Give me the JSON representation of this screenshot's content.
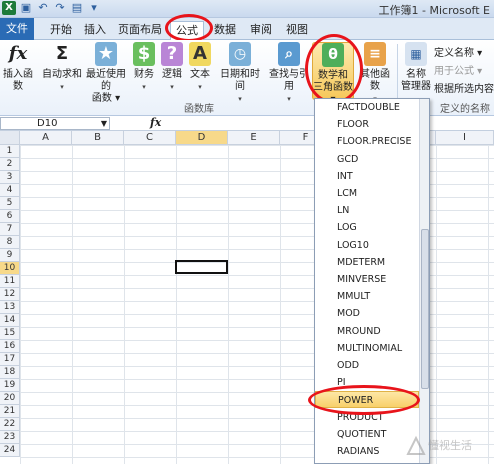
{
  "window": {
    "title": "工作簿1 - Microsoft E"
  },
  "tabs": [
    "文件",
    "开始",
    "插入",
    "页面布局",
    "公式",
    "数据",
    "审阅",
    "视图"
  ],
  "ribbon": {
    "buttons": [
      {
        "label1": "插入函数",
        "label2": "",
        "icon": "fx-icon"
      },
      {
        "label1": "自动求和",
        "label2": "▾",
        "icon": "sigma-icon"
      },
      {
        "label1": "最近使用的",
        "label2": "函数 ▾",
        "icon": "book-star-icon"
      },
      {
        "label1": "财务",
        "label2": "▾",
        "icon": "book-finance-icon"
      },
      {
        "label1": "逻辑",
        "label2": "▾",
        "icon": "book-question-icon"
      },
      {
        "label1": "文本",
        "label2": "▾",
        "icon": "book-text-icon"
      },
      {
        "label1": "日期和时间",
        "label2": "▾",
        "icon": "book-clock-icon"
      },
      {
        "label1": "查找与引用",
        "label2": "▾",
        "icon": "book-search-icon"
      },
      {
        "label1": "数学和",
        "label2": "三角函数 ▾",
        "icon": "book-theta-icon"
      },
      {
        "label1": "其他函数",
        "label2": "▾",
        "icon": "book-more-icon"
      },
      {
        "label1": "名称",
        "label2": "管理器",
        "icon": "name-manager-icon"
      }
    ],
    "group_label": "函数库",
    "side_items": [
      "定义名称 ▾",
      "用于公式 ▾",
      "根据所选内容"
    ],
    "side_group_label": "定义的名称"
  },
  "formula_bar": {
    "name_box": "D10",
    "fx": "fx"
  },
  "grid": {
    "columns": [
      "A",
      "B",
      "C",
      "D",
      "E",
      "F",
      "G",
      "H",
      "I"
    ],
    "rows": [
      "1",
      "2",
      "3",
      "4",
      "5",
      "6",
      "7",
      "8",
      "9",
      "10",
      "11",
      "12",
      "13",
      "14",
      "15",
      "16",
      "17",
      "18",
      "19",
      "20",
      "21",
      "22",
      "23",
      "24"
    ],
    "selected_cell": "D10"
  },
  "dropdown": {
    "items": [
      "FACTDOUBLE",
      "FLOOR",
      "FLOOR.PRECISE",
      "GCD",
      "INT",
      "LCM",
      "LN",
      "LOG",
      "LOG10",
      "MDETERM",
      "MINVERSE",
      "MMULT",
      "MOD",
      "MROUND",
      "MULTINOMIAL",
      "ODD",
      "PI",
      "POWER",
      "PRODUCT",
      "QUOTIENT",
      "RADIANS"
    ],
    "highlighted": "POWER"
  },
  "colors": {
    "accent": "#2a6bb5",
    "highlight": "#e8141b"
  }
}
